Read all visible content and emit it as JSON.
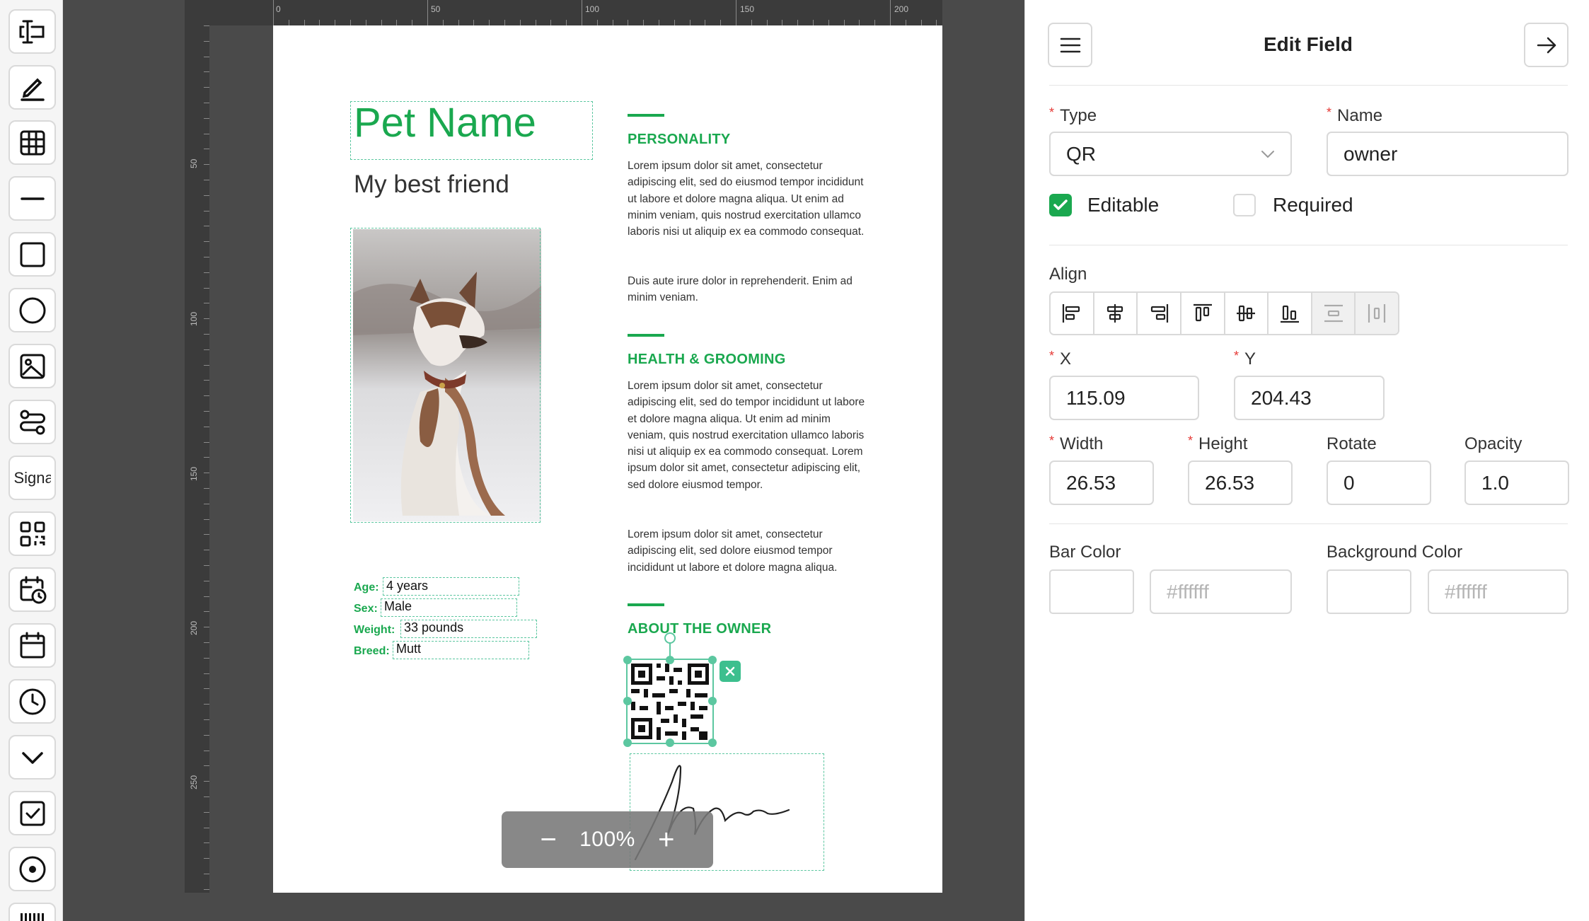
{
  "toolbar": {
    "items": [
      {
        "name": "text",
        "icon": "text-field-icon"
      },
      {
        "name": "pen",
        "icon": "pen-icon"
      },
      {
        "name": "table",
        "icon": "table-icon"
      },
      {
        "name": "line",
        "icon": "line-icon"
      },
      {
        "name": "rectangle",
        "icon": "rectangle-icon"
      },
      {
        "name": "ellipse",
        "icon": "circle-icon"
      },
      {
        "name": "image",
        "icon": "image-icon"
      },
      {
        "name": "svg",
        "icon": "path-icon"
      },
      {
        "name": "signature",
        "label": "Signa"
      },
      {
        "name": "qr",
        "icon": "qr-code-icon"
      },
      {
        "name": "date-time",
        "icon": "calendar-clock-icon"
      },
      {
        "name": "date",
        "icon": "calendar-icon"
      },
      {
        "name": "time",
        "icon": "clock-icon"
      },
      {
        "name": "select",
        "icon": "chevron-down-icon"
      },
      {
        "name": "checkbox",
        "icon": "checkbox-icon"
      },
      {
        "name": "radio",
        "icon": "radio-icon"
      },
      {
        "name": "barcode",
        "icon": "barcode-icon"
      }
    ]
  },
  "ruler": {
    "top": [
      "0",
      "50",
      "100",
      "150",
      "200"
    ],
    "left": [
      "50",
      "100",
      "150",
      "200",
      "250"
    ]
  },
  "page": {
    "pet_name": "Pet Name",
    "subtitle": "My best friend",
    "info": [
      {
        "label": "Age:",
        "value": "4 years"
      },
      {
        "label": "Sex:",
        "value": "Male"
      },
      {
        "label": "Weight:",
        "value": "33 pounds"
      },
      {
        "label": "Breed:",
        "value": "Mutt"
      }
    ],
    "sections": [
      {
        "title": "PERSONALITY",
        "paragraphs": [
          "Lorem ipsum dolor sit amet, consectetur adipiscing elit, sed do eiusmod tempor incididunt ut labore et dolore magna aliqua. Ut enim ad minim veniam, quis nostrud exercitation ullamco laboris nisi ut aliquip ex ea commodo consequat.",
          "Duis aute irure dolor in reprehenderit. Enim ad minim veniam."
        ]
      },
      {
        "title": "HEALTH & GROOMING",
        "paragraphs": [
          "Lorem ipsum dolor sit amet, consectetur adipiscing elit, sed do tempor incididunt ut labore et dolore magna aliqua. Ut enim ad minim veniam, quis nostrud exercitation ullamco laboris nisi ut aliquip ex ea commodo consequat. Lorem ipsum dolor sit amet, consectetur adipiscing elit, sed dolore eiusmod tempor.",
          "Lorem ipsum dolor sit amet, consectetur adipiscing elit, sed dolore eiusmod tempor incididunt ut labore et dolore magna aliqua."
        ]
      },
      {
        "title": "ABOUT THE OWNER",
        "paragraphs": []
      }
    ]
  },
  "zoom": {
    "minus": "−",
    "value": "100%",
    "plus": "+"
  },
  "panel": {
    "title": "Edit Field",
    "type_label": "Type",
    "type_value": "QR",
    "name_label": "Name",
    "name_value": "owner",
    "editable_label": "Editable",
    "editable_checked": true,
    "required_label": "Required",
    "required_checked": false,
    "align_label": "Align",
    "x_label": "X",
    "x_value": "115.09",
    "y_label": "Y",
    "y_value": "204.43",
    "width_label": "Width",
    "width_value": "26.53",
    "height_label": "Height",
    "height_value": "26.53",
    "rotate_label": "Rotate",
    "rotate_value": "0",
    "opacity_label": "Opacity",
    "opacity_value": "1.0",
    "bar_color_label": "Bar Color",
    "bar_color_placeholder": "#ffffff",
    "bg_color_label": "Background Color",
    "bg_color_placeholder": "#ffffff"
  },
  "colors": {
    "accent": "#1aa84f",
    "selection": "#5cc7a0",
    "canvas": "#4a4a4a"
  }
}
